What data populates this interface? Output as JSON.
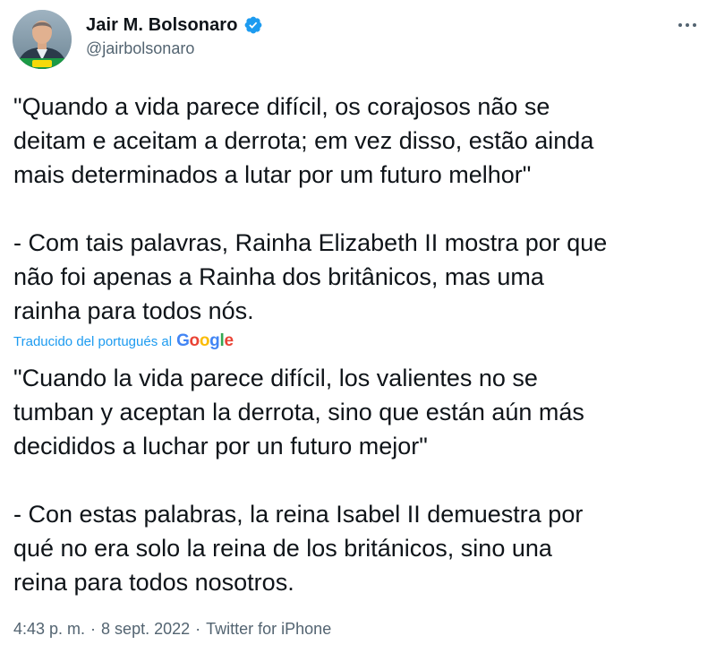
{
  "author": {
    "name": "Jair M. Bolsonaro",
    "handle": "@jairbolsonaro"
  },
  "icons": {
    "verified": "verified-badge-icon",
    "more": "more-options-icon"
  },
  "tweet": {
    "original_text": "\"Quando a vida parece difícil, os corajosos não se\ndeitam e aceitam a derrota; em vez disso, estão ainda\nmais determinados a lutar por um futuro melhor\"\n\n- Com tais palavras, Rainha Elizabeth II mostra por que\nnão foi apenas a Rainha dos britânicos, mas uma\nrainha para todos nós.",
    "translation_label": "Traducido del portugués al",
    "translation_provider": "Google",
    "translated_text": "\"Cuando la vida parece difícil, los valientes no se\ntumban y aceptan la derrota, sino que están aún más\ndecididos a luchar por un futuro mejor\"\n\n- Con estas palabras, la reina Isabel II demuestra por\nqué no era solo la reina de los británicos, sino una\nreina para todos nosotros."
  },
  "meta": {
    "time": "4:43 p. m.",
    "separator": "·",
    "date": "8 sept. 2022",
    "source": "Twitter for iPhone"
  },
  "colors": {
    "link_blue": "#1d9bf0",
    "text": "#0f1419",
    "secondary": "#536471",
    "verified_blue": "#1d9bf0"
  }
}
